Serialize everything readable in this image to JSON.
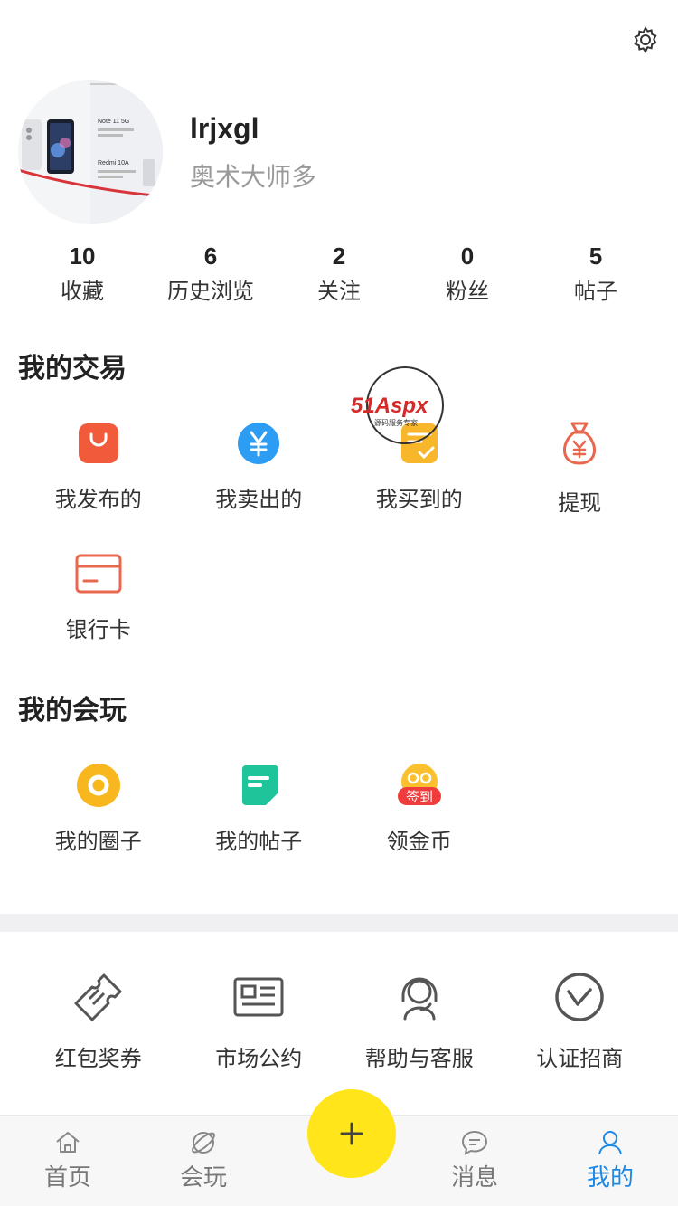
{
  "profile": {
    "username": "lrjxgl",
    "bio": "奥术大师多"
  },
  "stats": [
    {
      "num": "10",
      "label": "收藏"
    },
    {
      "num": "6",
      "label": "历史浏览"
    },
    {
      "num": "2",
      "label": "关注"
    },
    {
      "num": "0",
      "label": "粉丝"
    },
    {
      "num": "5",
      "label": "帖子"
    }
  ],
  "trade": {
    "title": "我的交易",
    "items": [
      {
        "label": "我发布的",
        "icon": "shopping-bag-icon"
      },
      {
        "label": "我卖出的",
        "icon": "yen-coin-icon"
      },
      {
        "label": "我买到的",
        "icon": "check-note-icon"
      },
      {
        "label": "提现",
        "icon": "money-bag-icon"
      },
      {
        "label": "银行卡",
        "icon": "bank-card-icon"
      }
    ]
  },
  "play": {
    "title": "我的会玩",
    "items": [
      {
        "label": "我的圈子",
        "icon": "circle-icon"
      },
      {
        "label": "我的帖子",
        "icon": "post-note-icon"
      },
      {
        "label": "领金币",
        "icon": "sign-in-coin-icon",
        "badge": "签到"
      }
    ]
  },
  "tools": [
    {
      "label": "红包奖券",
      "icon": "ticket-icon"
    },
    {
      "label": "市场公约",
      "icon": "news-icon"
    },
    {
      "label": "帮助与客服",
      "icon": "headset-icon"
    },
    {
      "label": "认证招商",
      "icon": "verified-v-icon"
    }
  ],
  "avatar_text": {
    "line1": "Note 11 5G",
    "line2": "Redmi 10A"
  },
  "watermark": {
    "brand": "51Aspx",
    "sub": "源码服务专家"
  },
  "tabbar": [
    {
      "label": "首页",
      "icon": "home-icon"
    },
    {
      "label": "会玩",
      "icon": "planet-icon"
    },
    {
      "label": "",
      "icon": "plus-icon"
    },
    {
      "label": "消息",
      "icon": "message-icon"
    },
    {
      "label": "我的",
      "icon": "user-icon"
    }
  ],
  "colors": {
    "accent": "#1e88e5",
    "fab": "#ffe51a",
    "bag": "#f25a3c",
    "yen": "#2d9cf3",
    "check": "#f8b72a",
    "money": "#e8674e",
    "circle": "#f8b71e",
    "post": "#1fc49a"
  }
}
